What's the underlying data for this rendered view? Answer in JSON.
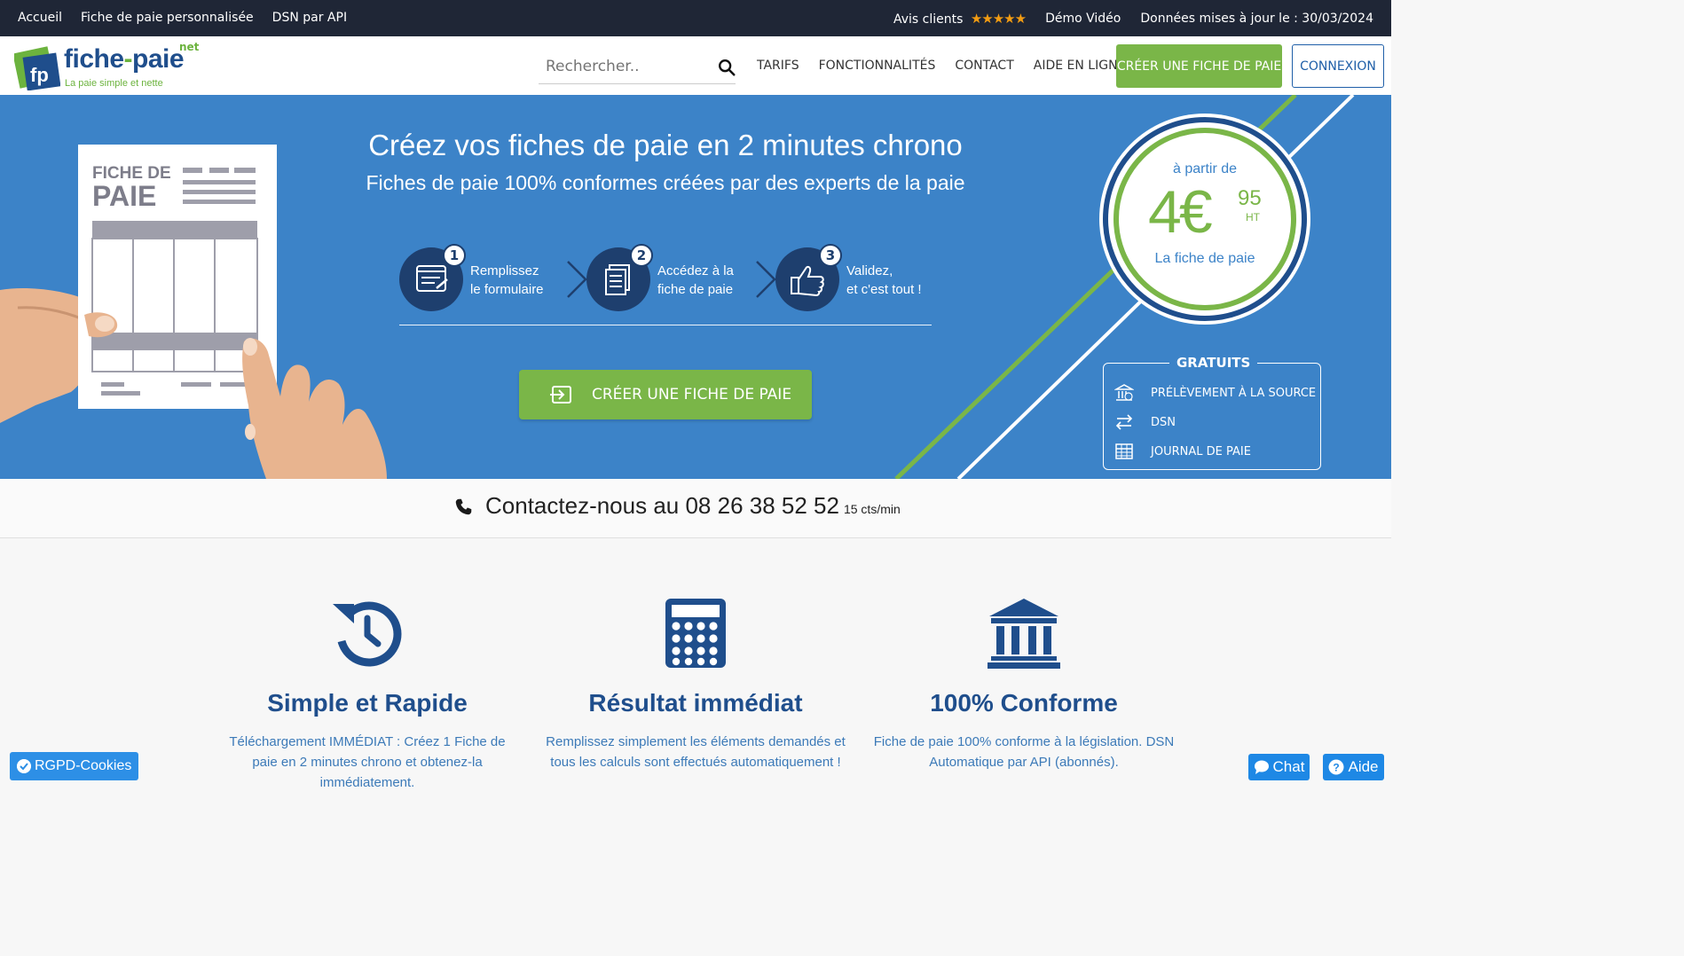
{
  "topbar": {
    "links": [
      "Accueil",
      "Fiche de paie personnalisée",
      "DSN par API"
    ],
    "reviews_label": "Avis clients",
    "stars": "★★★★★",
    "demo": "Démo Vidéo",
    "updated": "Données mises à jour le : 30/03/2024"
  },
  "header": {
    "logo_fp": "fp",
    "logo_brand_a": "fiche",
    "logo_brand_dash": "-",
    "logo_brand_b": "paie",
    "logo_net": "net",
    "logo_tagline": "La paie simple et nette",
    "search_placeholder": "Rechercher..",
    "nav": [
      "TARIFS",
      "FONCTIONNALITÉS",
      "CONTACT",
      "AIDE EN LIGNE"
    ],
    "create_button": "CRÉER UNE FICHE DE PAIE",
    "login_button": "CONNEXION"
  },
  "hero": {
    "title": "Créez vos fiches de paie en 2 minutes chrono",
    "subtitle": "Fiches de paie 100% conformes créées par des experts de la paie",
    "illustration_title_1": "FICHE DE",
    "illustration_title_2": "PAIE",
    "steps": [
      {
        "num": "1",
        "line1": "Remplissez",
        "line2": "le formulaire"
      },
      {
        "num": "2",
        "line1": "Accédez à la",
        "line2": "fiche de paie"
      },
      {
        "num": "3",
        "line1": "Validez,",
        "line2": "et c'est tout !"
      }
    ],
    "cta": "CRÉER UNE FICHE DE PAIE",
    "price": {
      "from": "à partir de",
      "amount": "4€",
      "cents": "95",
      "tax": "HT",
      "unit": "La fiche de paie"
    },
    "free": {
      "title": "GRATUITS",
      "items": [
        "PRÉLÈVEMENT À LA SOURCE",
        "DSN",
        "JOURNAL DE PAIE"
      ]
    }
  },
  "contact": {
    "text": "Contactez-nous au 08 26 38 52 52",
    "rate": "15 cts/min"
  },
  "features": [
    {
      "icon": "history-icon",
      "title": "Simple et Rapide",
      "text": "Téléchargement IMMÉDIAT : Créez 1 Fiche de paie en 2 minutes chrono et obtenez-la immédiatement."
    },
    {
      "icon": "calculator-icon",
      "title": "Résultat immédiat",
      "text": "Remplissez simplement les éléments demandés et tous les calculs sont effectués automatiquement !"
    },
    {
      "icon": "bank-icon",
      "title": "100% Conforme",
      "text": "Fiche de paie 100% conforme à la législation. DSN Automatique par API (abonnés)."
    }
  ],
  "widgets": {
    "rgpd": "RGPD-Cookies",
    "chat": "Chat",
    "aide": "Aide"
  },
  "colors": {
    "topbar": "#1f2636",
    "hero_bg": "#3c83c8",
    "green": "#7ab648",
    "dark_blue": "#1f4e8c",
    "step_circle": "#1e3f6e"
  }
}
